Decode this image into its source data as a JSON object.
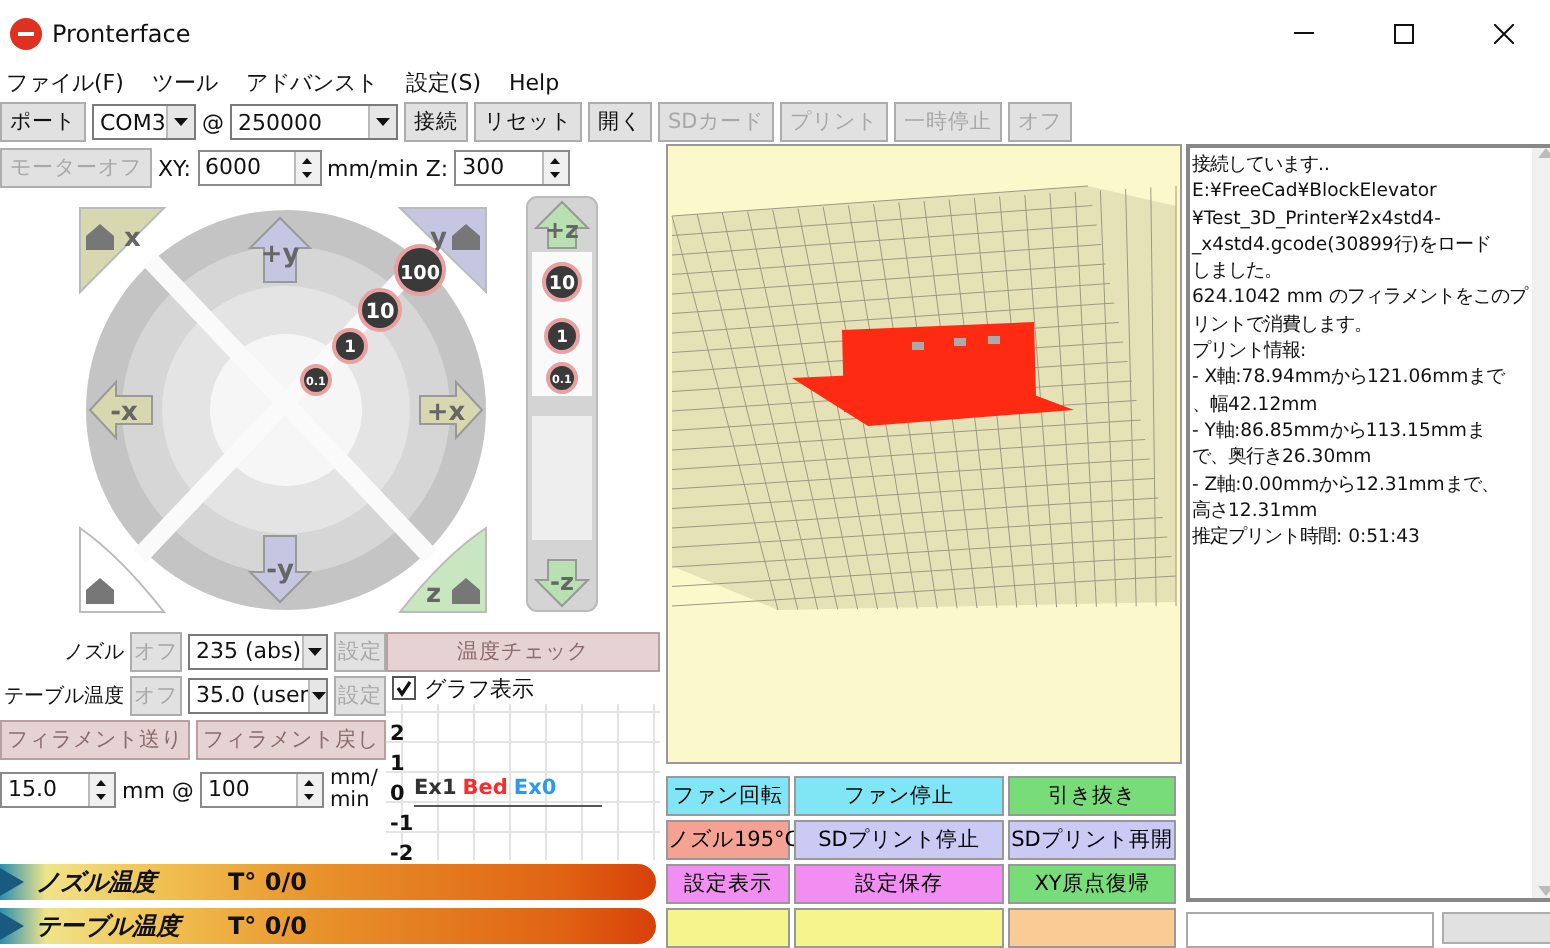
{
  "window": {
    "title": "Pronterface"
  },
  "menu": [
    "ファイル(F)",
    "ツール",
    "アドバンスト",
    "設定(S)",
    "Help"
  ],
  "toolbar": {
    "port_label": "ポート",
    "port": "COM3",
    "at": "@",
    "baud": "250000",
    "buttons": [
      {
        "label": "接続",
        "disabled": false
      },
      {
        "label": "リセット",
        "disabled": false
      },
      {
        "label": "開く",
        "disabled": false
      },
      {
        "label": "SDカード",
        "disabled": true
      },
      {
        "label": "プリント",
        "disabled": true
      },
      {
        "label": "一時停止",
        "disabled": true
      },
      {
        "label": "オフ",
        "disabled": true
      }
    ]
  },
  "motion": {
    "motors_off": "モーターオフ",
    "xy_label": "XY:",
    "xy_feed": "6000",
    "unit_label": "mm/min Z:",
    "z_feed": "300"
  },
  "jog": {
    "home_x": "x",
    "home_y": "y",
    "home_z": "z",
    "plus_y": "+y",
    "minus_y": "-y",
    "minus_x": "-x",
    "plus_x": "+x",
    "steps": [
      "100",
      "10",
      "1",
      "0.1"
    ],
    "plus_z": "+z",
    "minus_z": "-z",
    "z_steps": [
      "10",
      "1",
      "0.1"
    ]
  },
  "temperature": {
    "heaters": [
      {
        "label": "ノズル",
        "off": "オフ",
        "value": "235 (abs)",
        "set": "設定"
      },
      {
        "label": "テーブル温度",
        "off": "オフ",
        "value": "35.0 (user",
        "set": "設定"
      }
    ],
    "check": "温度チェック",
    "graph_toggle": {
      "label": "グラフ表示",
      "checked": true
    },
    "extrude": "フィラメント送り",
    "reverse": "フィラメント戻し",
    "length": "15.0",
    "length_unit": "mm @",
    "speed": "100",
    "speed_unit": "mm/ min"
  },
  "graph": {
    "ticks": [
      "2",
      "1",
      "0",
      "-1",
      "-2"
    ],
    "legend": [
      {
        "label": "Ex1",
        "color": "#333333"
      },
      {
        "label": "Bed",
        "color": "#ff2a2a"
      },
      {
        "label": "Ex0",
        "color": "#2a9af0"
      }
    ]
  },
  "gauges": [
    {
      "label": "ノズル温度",
      "reading": "T° 0/0"
    },
    {
      "label": "テーブル温度",
      "reading": "T° 0/0"
    }
  ],
  "macros": [
    {
      "label": "ファン回転",
      "color": "#80e6f5"
    },
    {
      "label": "ファン停止",
      "color": "#80e6f5"
    },
    {
      "label": "引き抜き",
      "color": "#78dc78"
    },
    {
      "label": "ノズル195°C",
      "color": "#f5a294"
    },
    {
      "label": "SDプリント停止",
      "color": "#cacaf5"
    },
    {
      "label": "SDプリント再開",
      "color": "#cacaf5"
    },
    {
      "label": "設定表示",
      "color": "#f28ef2"
    },
    {
      "label": "設定保存",
      "color": "#f28ef2"
    },
    {
      "label": "XY原点復帰",
      "color": "#78dc78"
    },
    {
      "color": "#f5f58c"
    },
    {
      "color": "#f5f58c"
    },
    {
      "color": "#f8cc94"
    }
  ],
  "log": [
    "接続しています..",
    "E:¥FreeCad¥BlockElevator",
    "¥Test_3D_Printer¥2x4std4-",
    "_x4std4.gcode(30899行)をロード",
    "しました。",
    "624.1042 mm のフィラメントをこのプ",
    "リントで消費します。",
    "プリント情報:",
    "- X軸:78.94mmから121.06mmまで",
    "、幅42.12mm",
    "- Y軸:86.85mmから113.15mmま",
    "で、奥行き26.30mm",
    "- Z軸:0.00mmから12.31mmまで、",
    "高さ12.31mm",
    "推定プリント時間: 0:51:43"
  ]
}
